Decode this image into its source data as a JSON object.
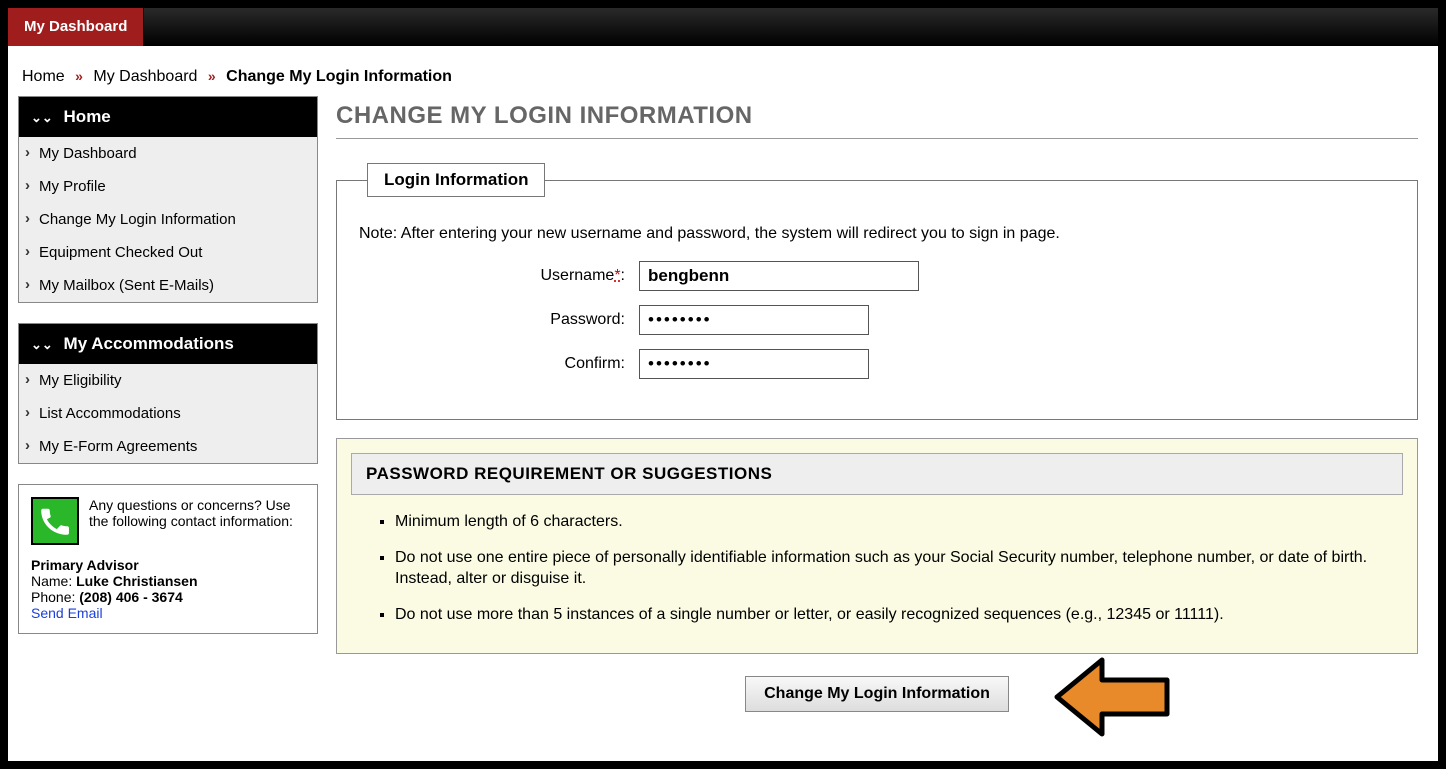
{
  "top_tab": "My Dashboard",
  "breadcrumb": [
    "Home",
    "My Dashboard",
    "Change My Login Information"
  ],
  "sidebar": {
    "sections": [
      {
        "title": "Home",
        "items": [
          "My Dashboard",
          "My Profile",
          "Change My Login Information",
          "Equipment Checked Out",
          "My Mailbox (Sent E-Mails)"
        ]
      },
      {
        "title": "My Accommodations",
        "items": [
          "My Eligibility",
          "List Accommodations",
          "My E-Form Agreements"
        ]
      }
    ]
  },
  "contact": {
    "intro": "Any questions or concerns? Use the following contact information:",
    "advisor_label": "Primary Advisor",
    "name_label": "Name:",
    "name_value": "Luke Christiansen",
    "phone_label": "Phone:",
    "phone_value": "(208) 406 - 3674",
    "send_email": "Send Email"
  },
  "page_title": "CHANGE MY LOGIN INFORMATION",
  "form": {
    "legend": "Login Information",
    "note": "Note: After entering your new username and password, the system will redirect you to sign in page.",
    "username_label": "Username",
    "username_value": "bengbenn",
    "password_label": "Password:",
    "password_value": "••••••••",
    "confirm_label": "Confirm:",
    "confirm_value": "••••••••"
  },
  "pw_requirements": {
    "title": "PASSWORD REQUIREMENT OR SUGGESTIONS",
    "items": [
      "Minimum length of 6 characters.",
      "Do not use one entire piece of personally identifiable information such as your Social Security number, telephone number, or date of birth. Instead, alter or disguise it.",
      "Do not use more than 5 instances of a single number or letter, or easily recognized sequences (e.g., 12345 or 11111)."
    ]
  },
  "submit_label": "Change My Login Information"
}
